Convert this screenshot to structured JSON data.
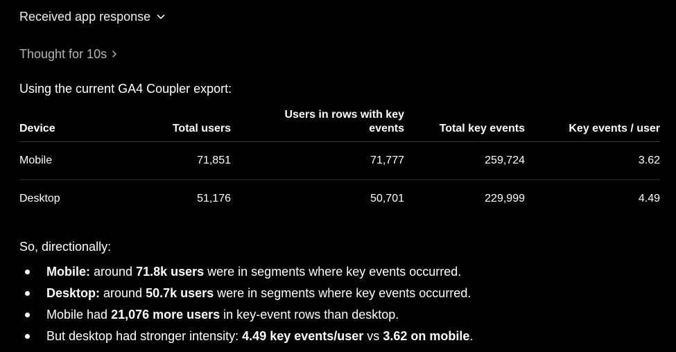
{
  "header": {
    "response_label": "Received app response",
    "thought_label": "Thought for 10s"
  },
  "intro": "Using the current GA4 Coupler export:",
  "table": {
    "headers": {
      "device": "Device",
      "total_users": "Total users",
      "users_in_rows": "Users in rows with key events",
      "total_key_events": "Total key events",
      "key_events_per_user": "Key events / user"
    },
    "rows": [
      {
        "device": "Mobile",
        "total_users": "71,851",
        "users_in_rows": "71,777",
        "total_key_events": "259,724",
        "key_events_per_user": "3.62"
      },
      {
        "device": "Desktop",
        "total_users": "51,176",
        "users_in_rows": "50,701",
        "total_key_events": "229,999",
        "key_events_per_user": "4.49"
      }
    ]
  },
  "summary": "So, directionally:",
  "bullets": [
    {
      "b1": "Mobile:",
      "t1": " around ",
      "b2": "71.8k users",
      "t2": " were in segments where key events occurred."
    },
    {
      "b1": "Desktop:",
      "t1": " around ",
      "b2": "50.7k users",
      "t2": " were in segments where key events occurred."
    },
    {
      "t0": "Mobile had ",
      "b1": "21,076 more users",
      "t1": " in key-event rows than desktop."
    },
    {
      "t0": "But desktop had stronger intensity: ",
      "b1": "4.49 key events/user",
      "t1": " vs ",
      "b2": "3.62 on mobile",
      "t2": "."
    }
  ],
  "colors": {
    "background": "#000000",
    "text": "#ffffff",
    "muted_text": "#b4b4b4",
    "divider": "#3a3a3a"
  },
  "icons": {
    "response_toggle": "chevron-down-icon",
    "thought_toggle": "chevron-right-icon",
    "bullet": "bullet-dot-icon"
  }
}
